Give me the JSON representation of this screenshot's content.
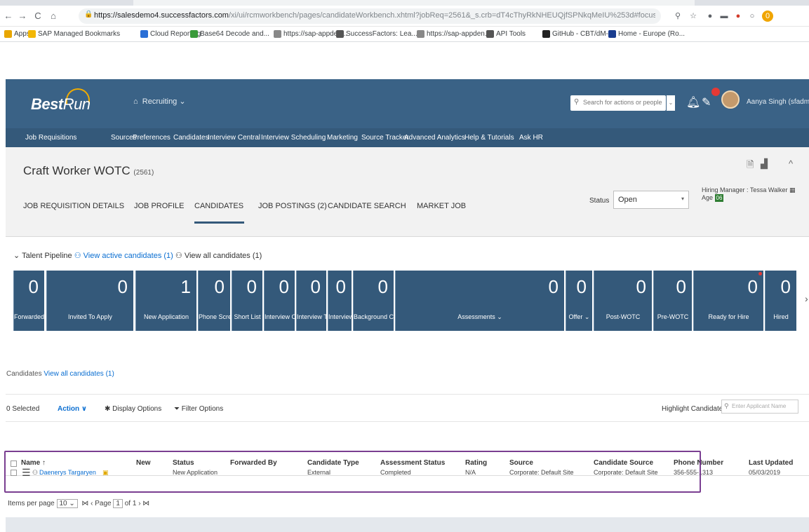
{
  "browser": {
    "url_main": "https://salesdemo4.successfactors.com",
    "url_rest": "/xi/ui/rcmworkbench/pages/candidateWorkbench.xhtml?jobReq=2561&_s.crb=dT4cThyRkNHEUQjfSPNkqMeIU%253d#focus",
    "bookmarks": [
      {
        "label": "Apps",
        "color": "#e8a600"
      },
      {
        "label": "SAP Managed Bookmarks",
        "color": "#f2b705"
      },
      {
        "label": "Cloud Reporting",
        "color": "#2a6fd6"
      },
      {
        "label": "Base64 Decode and...",
        "color": "#3a9a3a"
      },
      {
        "label": "https://sap-appden...",
        "color": "#888888"
      },
      {
        "label": "SuccessFactors: Lea...",
        "color": "#555555"
      },
      {
        "label": "https://sap-appden...",
        "color": "#888888"
      },
      {
        "label": "API Tools",
        "color": "#555555"
      },
      {
        "label": "GitHub - CBT/dM-t...",
        "color": "#222222"
      },
      {
        "label": "Home - Europe (Ro...",
        "color": "#1a3d8f"
      }
    ]
  },
  "header": {
    "logo_best": "Best",
    "logo_run": "Run",
    "home_menu": "Recruiting",
    "search_placeholder": "Search for actions or people",
    "user_name": "Aanya Singh (sfadmin)",
    "nav": [
      "Job Requisitions",
      "Sources",
      "Preferences",
      "Candidates",
      "Interview Central",
      "Interview Scheduling",
      "Marketing",
      "Source Tracker",
      "Advanced Analytics",
      "Help & Tutorials",
      "Ask HR"
    ]
  },
  "requisition": {
    "title": "Craft Worker WOTC",
    "id": "(2561)",
    "tabs": [
      "JOB REQUISITION DETAILS",
      "JOB PROFILE",
      "CANDIDATES",
      "JOB POSTINGS (2)",
      "CANDIDATE SEARCH",
      "MARKET JOB"
    ],
    "status_label": "Status",
    "status_value": "Open",
    "hiring_manager": "Hiring Manager : Tessa Walker",
    "age_label": "Age",
    "age_value": "06"
  },
  "pipeline": {
    "title": "Talent Pipeline",
    "view_active": "View active candidates (1)",
    "view_all": "View all candidates (1)",
    "stages": [
      {
        "count": "0",
        "label": "Forwarded"
      },
      {
        "count": "0",
        "label": "Invited To Apply"
      },
      {
        "count": "1",
        "label": "New Application"
      },
      {
        "count": "0",
        "label": "Phone Screen"
      },
      {
        "count": "0",
        "label": "Short List"
      },
      {
        "count": "0",
        "label": "Interview One"
      },
      {
        "count": "0",
        "label": "Interview Two"
      },
      {
        "count": "0",
        "label": "Interview ⌄"
      },
      {
        "count": "0",
        "label": "Background Check"
      },
      {
        "count": "0",
        "label": "Assessments ⌄"
      },
      {
        "count": "0",
        "label": "Offer ⌄"
      },
      {
        "count": "0",
        "label": "Post-WOTC"
      },
      {
        "count": "0",
        "label": "Pre-WOTC"
      },
      {
        "count": "0",
        "label": "Ready for Hire"
      },
      {
        "count": "0",
        "label": "Hired"
      }
    ]
  },
  "candidates": {
    "header_label": "Candidates",
    "view_all": "View all candidates (1)",
    "selected": "0 Selected",
    "action": "Action",
    "display_options": "Display Options",
    "filter_options": "Filter Options",
    "highlight_label": "Highlight Candidate",
    "highlight_placeholder": "Enter Applicant Name",
    "columns": [
      "Name ↑",
      "New",
      "Status",
      "Forwarded By",
      "Candidate Type",
      "Assessment Status",
      "Rating",
      "Source",
      "Candidate Source",
      "Phone Number",
      "Last Updated"
    ],
    "rows": [
      {
        "name": "Daenerys Targaryen",
        "new": "",
        "status": "New Application",
        "forwarded_by": "",
        "candidate_type": "External",
        "assessment_status": "Completed",
        "rating": "N/A",
        "source": "Corporate: Default Site",
        "candidate_source": "Corporate: Default Site",
        "phone": "356-555-1313",
        "last_updated": "05/03/2019"
      }
    ],
    "pager_label": "Items per page",
    "per_page": "10",
    "page_label": "Page",
    "page_num": "1",
    "page_of": "of 1"
  }
}
